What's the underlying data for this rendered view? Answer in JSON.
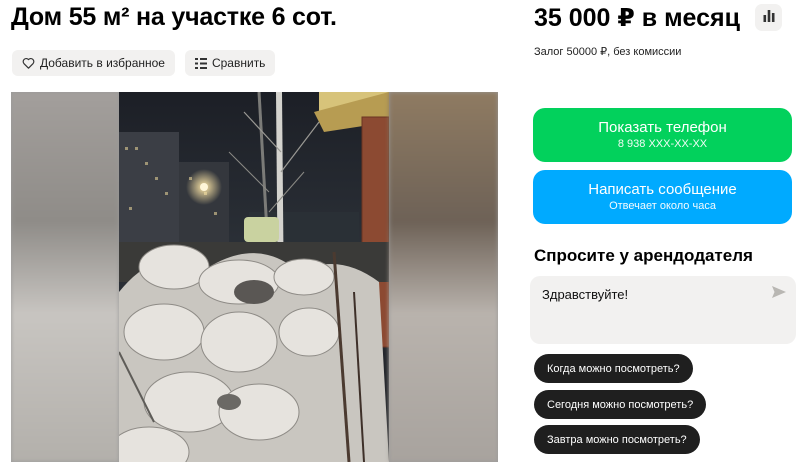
{
  "listing": {
    "title": "Дом 55 м² на участке 6 сот.",
    "price": "35 000 ₽ в месяц",
    "deposit": "Залог 50000 ₽, без комиссии"
  },
  "actions": {
    "favorite_label": "Добавить в избранное",
    "compare_label": "Сравнить"
  },
  "contact": {
    "phone_label": "Показать телефон",
    "phone_masked": "8 938 XXX-XX-XX",
    "message_label": "Написать сообщение",
    "message_sub": "Отвечает около часа"
  },
  "ask": {
    "title": "Спросите у арендодателя",
    "input_value": "Здравствуйте!",
    "quick_replies": [
      "Когда можно посмотреть?",
      "Сегодня можно посмотреть?",
      "Завтра можно посмотреть?"
    ]
  },
  "icons": {
    "favorite": "heart-icon",
    "compare": "compare-icon",
    "stats": "bar-chart-icon",
    "send": "send-icon"
  },
  "colors": {
    "phone_button": "#02d15c",
    "message_button": "#00aaff",
    "chip_bg": "#f2f1f0",
    "quick_reply_bg": "#1f1f1f"
  }
}
